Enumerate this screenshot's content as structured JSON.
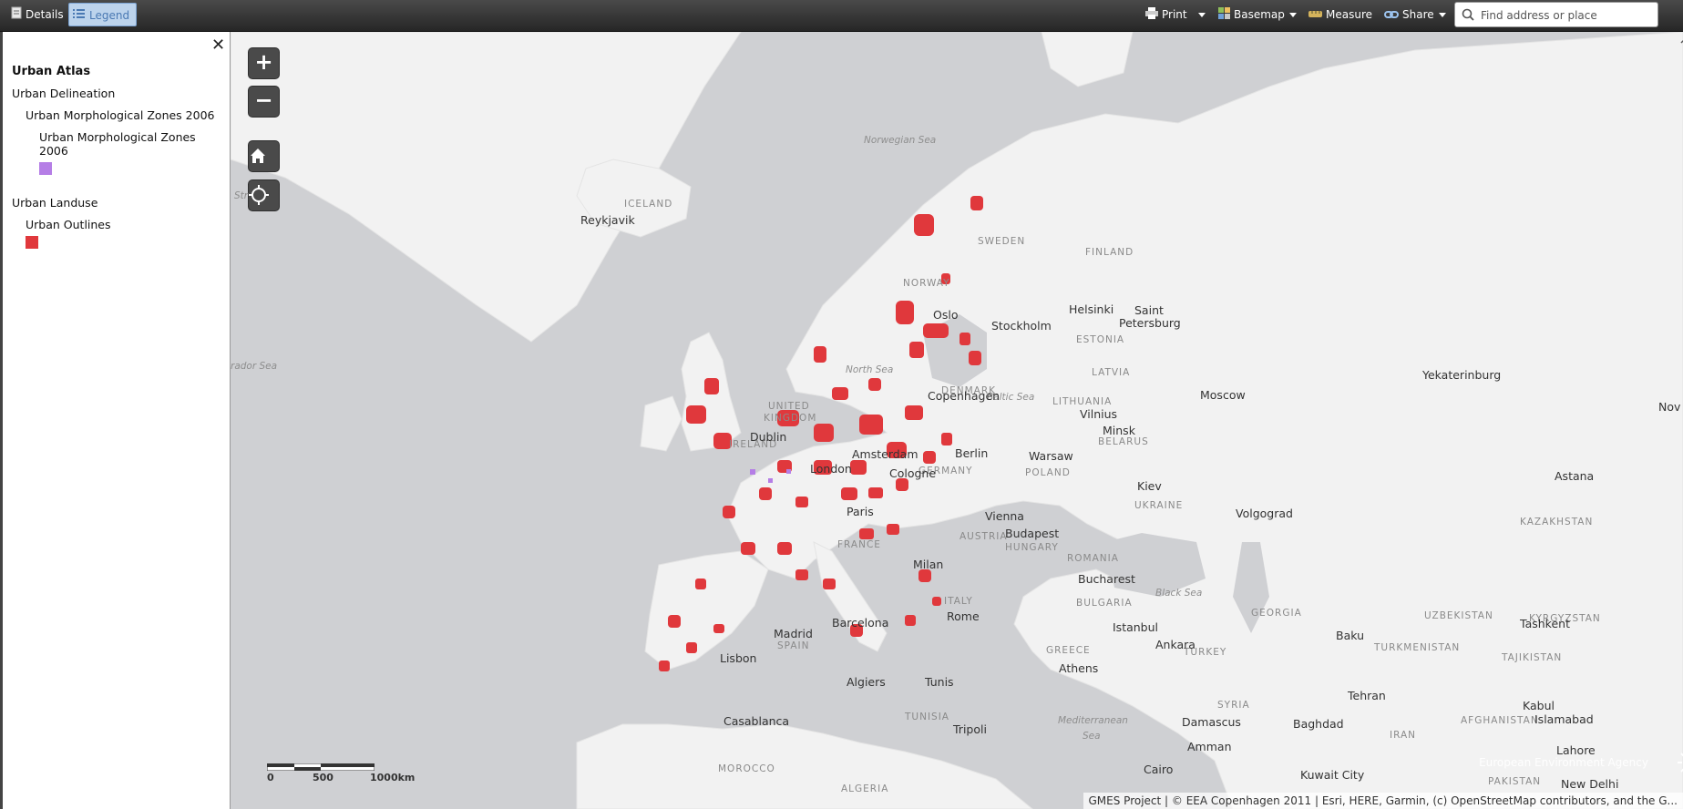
{
  "toolbar": {
    "details_label": "Details",
    "legend_label": "Legend",
    "print_label": "Print",
    "basemap_label": "Basemap",
    "measure_label": "Measure",
    "share_label": "Share",
    "search_placeholder": "Find address or place"
  },
  "legend": {
    "title": "Urban Atlas",
    "groups": [
      {
        "label": "Urban Delineation"
      },
      {
        "label": "Urban Morphological Zones 2006"
      },
      {
        "label": "Urban Morphological Zones 2006"
      },
      {
        "label": "Urban Landuse"
      },
      {
        "label": "Urban Outlines"
      }
    ],
    "colors": {
      "umz": "#b57ee6",
      "outlines": "#e0383c"
    }
  },
  "map": {
    "zoom_in": "+",
    "zoom_out": "−",
    "labels": {
      "norwegian_sea": "Norwegian Sea",
      "north_sea": "North Sea",
      "baltic_sea": "Baltic Sea",
      "labrador_sea": "rador Sea",
      "strait": "Str",
      "black_sea": "Black Sea",
      "mediterranean": "Mediterranean",
      "mediterranean2": "Sea",
      "iceland": "ICELAND",
      "sweden": "SWEDEN",
      "finland": "FINLAND",
      "norway": "NORWAY",
      "estonia": "ESTONIA",
      "latvia": "LATVIA",
      "lithuania": "LITHUANIA",
      "belarus": "BELARUS",
      "ukraine": "UKRAINE",
      "denmark": "DENMARK",
      "united": "UNITED",
      "kingdom": "KINGDOM",
      "ireland": "IRELAND",
      "germany": "GERMANY",
      "poland": "POLAND",
      "austria": "AUSTRIA",
      "hungary": "HUNGARY",
      "france": "FRANCE",
      "romania": "ROMANIA",
      "bulgaria": "BULGARIA",
      "italy": "ITALY",
      "spain": "SPAIN",
      "greece": "GREECE",
      "turkey": "TURKEY",
      "syria": "SYRIA",
      "georgia": "GEORGIA",
      "kazakhstan": "KAZAKHSTAN",
      "uzbekistan": "UZBEKISTAN",
      "kyrgyzstan": "KYRGYZSTAN",
      "turkmenistan": "TURKMENISTAN",
      "tajikistan": "TAJIKISTAN",
      "afghanistan": "AFGHANISTAN",
      "iran": "IRAN",
      "pakistan": "PAKISTAN",
      "tunisia": "TUNISIA",
      "morocco": "MOROCCO",
      "algeria": "ALGERIA",
      "reykjavik": "Reykjavik",
      "oslo": "Oslo",
      "stockholm": "Stockholm",
      "helsinki": "Helsinki",
      "saint": "Saint",
      "petersburg": "Petersburg",
      "copenhagen": "Copenhagen",
      "moscow": "Moscow",
      "yekaterinburg": "Yekaterinburg",
      "vilnius": "Vilnius",
      "minsk": "Minsk",
      "dublin": "Dublin",
      "amsterdam": "Amsterdam",
      "berlin": "Berlin",
      "warsaw": "Warsaw",
      "london": "London",
      "cologne": "Cologne",
      "kiev": "Kiev",
      "astana": "Astana",
      "paris": "Paris",
      "vienna": "Vienna",
      "budapest": "Budapest",
      "volgograd": "Volgograd",
      "milan": "Milan",
      "bucharest": "Bucharest",
      "barcelona": "Barcelona",
      "rome": "Rome",
      "istanbul": "Istanbul",
      "madrid": "Madrid",
      "tashkent": "Tashkent",
      "baku": "Baku",
      "ankara": "Ankara",
      "lisbon": "Lisbon",
      "athens": "Athens",
      "algiers": "Algiers",
      "tunis": "Tunis",
      "tehran": "Tehran",
      "kabul": "Kabul",
      "islamabad": "Islamabad",
      "casablanca": "Casablanca",
      "tripoli": "Tripoli",
      "damascus": "Damascus",
      "baghdad": "Baghdad",
      "amman": "Amman",
      "lahore": "Lahore",
      "cairo": "Cairo",
      "kuwait": "Kuwait City",
      "newdelhi": "New Delhi",
      "nov": "Nov"
    },
    "scale": {
      "s0": "0",
      "s1": "500",
      "s2": "1000km"
    },
    "attribution": "GMES Project | © EEA Copenhagen 2011 | Esri, HERE, Garmin, (c) OpenStreetMap contributors, and the G...",
    "logo_text": "European Environment Agency"
  }
}
